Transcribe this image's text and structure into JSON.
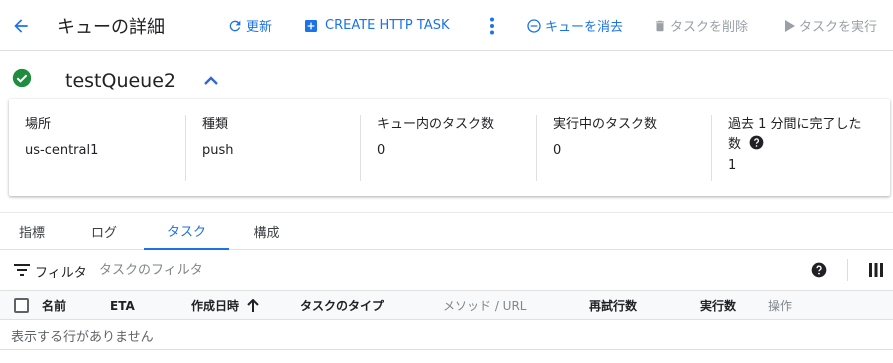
{
  "header": {
    "title": "キューの詳細",
    "refresh_label": "更新",
    "create_task_label": "CREATE HTTP TASK",
    "purge_label": "キューを消去",
    "delete_task_label": "タスクを削除",
    "run_task_label": "タスクを実行"
  },
  "queue": {
    "name": "testQueue2",
    "status_icon": "check-circle-icon",
    "status_color": "#1e8e3e"
  },
  "details": [
    {
      "label": "場所",
      "value": "us-central1"
    },
    {
      "label": "種類",
      "value": "push"
    },
    {
      "label": "キュー内のタスク数",
      "value": "0"
    },
    {
      "label": "実行中のタスク数",
      "value": "0"
    },
    {
      "label": "過去 1 分間に完了した数",
      "value": "1"
    }
  ],
  "tabs": [
    {
      "label": "指標"
    },
    {
      "label": "ログ"
    },
    {
      "label": "タスク",
      "active": true
    },
    {
      "label": "構成"
    }
  ],
  "filter": {
    "label": "フィルタ",
    "placeholder": "タスクのフィルタ"
  },
  "table": {
    "columns": [
      "名前",
      "ETA",
      "作成日時",
      "タスクのタイプ",
      "メソッド / URL",
      "再試行数",
      "実行数",
      "操作"
    ],
    "sorted_column": "作成日時",
    "empty_message": "表示する行がありません"
  },
  "colors": {
    "accent": "#1a73e8",
    "disabled": "#9aa0a6",
    "success": "#1e8e3e"
  }
}
